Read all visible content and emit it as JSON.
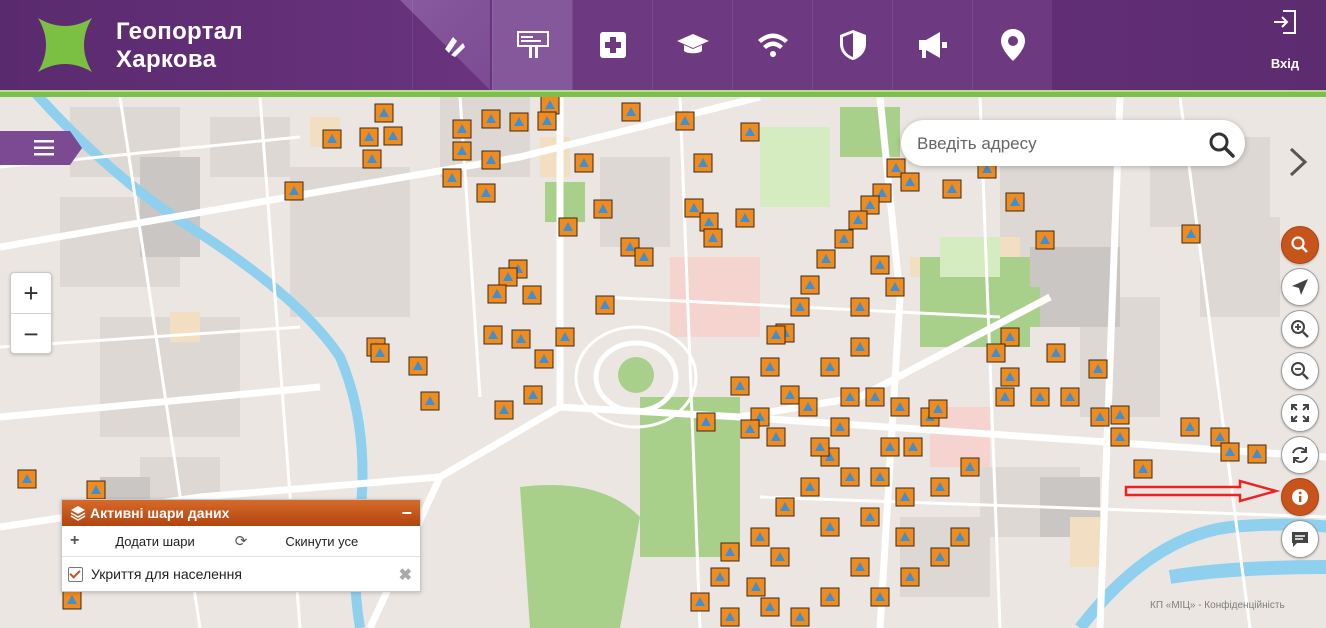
{
  "header": {
    "title_line1": "Геопортал",
    "title_line2": "Харкова",
    "login_label": "Вхід",
    "nav_icons": [
      "construction-icon",
      "billboard-icon",
      "medical-cross-icon",
      "graduation-cap-icon",
      "wifi-icon",
      "shield-icon",
      "megaphone-icon",
      "map-pin-icon"
    ],
    "brand_color": "#5f2d74",
    "accent_green": "#7cbf4a"
  },
  "search": {
    "placeholder": "Введіть адресу"
  },
  "map_controls": {
    "zoom_in": "+",
    "zoom_out": "−",
    "right_tools": [
      "search-icon",
      "locate-arrow-icon",
      "zoom-in-icon",
      "zoom-out-icon",
      "fullscreen-icon",
      "refresh-icon",
      "info-icon",
      "chat-icon"
    ]
  },
  "layers_panel": {
    "title": "Активні шари даних",
    "minimize": "−",
    "add_icon": "+",
    "add_label": "Додати шари",
    "reset_icon": "⟳",
    "reset_label": "Скинути усе",
    "items": [
      {
        "label": "Укриття для населення",
        "checked": true,
        "remove": "✖"
      }
    ]
  },
  "attribution": "КП «МІЦ» - Конфіденційність",
  "marker_color": "#f08c1e"
}
